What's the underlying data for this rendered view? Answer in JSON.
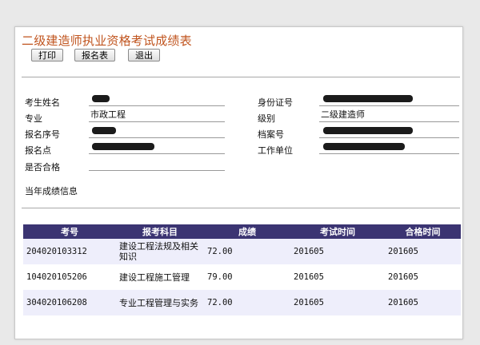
{
  "page": {
    "title": "二级建造师执业资格考试成绩表"
  },
  "toolbar": {
    "print_label": "打印",
    "form_label": "报名表",
    "exit_label": "退出"
  },
  "info": {
    "left": [
      {
        "label": "考生姓名",
        "value": ""
      },
      {
        "label": "专业",
        "value": "市政工程"
      },
      {
        "label": "报名序号",
        "value": ""
      },
      {
        "label": "报名点",
        "value": ""
      },
      {
        "label": "是否合格",
        "value": ""
      }
    ],
    "right": [
      {
        "label": "身份证号",
        "value": ""
      },
      {
        "label": "级别",
        "value": "二级建造师"
      },
      {
        "label": "档案号",
        "value": ""
      },
      {
        "label": "工作单位",
        "value": ""
      }
    ]
  },
  "results": {
    "section_title": "当年成绩信息",
    "columns": [
      "考号",
      "报考科目",
      "成绩",
      "考试时间",
      "合格时间"
    ],
    "rows": [
      {
        "exam_no": "204020103312",
        "subject": "建设工程法规及相关知识",
        "score": "72.00",
        "exam_time": "201605",
        "pass_time": "201605"
      },
      {
        "exam_no": "104020105206",
        "subject": "建设工程施工管理",
        "score": "79.00",
        "exam_time": "201605",
        "pass_time": "201605"
      },
      {
        "exam_no": "304020106208",
        "subject": "专业工程管理与实务",
        "score": "72.00",
        "exam_time": "201605",
        "pass_time": "201605"
      }
    ]
  },
  "colors": {
    "title": "#c0541e",
    "table_header": "#3b3472",
    "row_alt": "#eeeefb"
  }
}
